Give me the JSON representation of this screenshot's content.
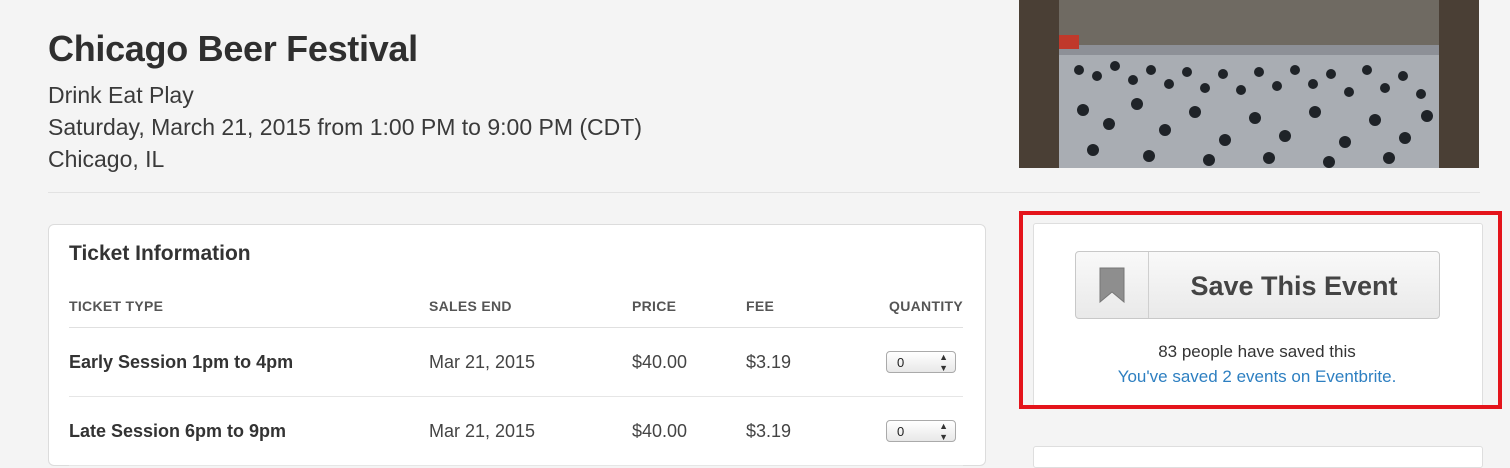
{
  "event": {
    "title": "Chicago Beer Festival",
    "subtitle": "Drink Eat Play",
    "date_time": "Saturday, March 21, 2015 from 1:00 PM to 9:00 PM (CDT)",
    "location": "Chicago, IL"
  },
  "tickets": {
    "header": "Ticket Information",
    "columns": [
      "TICKET TYPE",
      "SALES END",
      "PRICE",
      "FEE",
      "QUANTITY"
    ],
    "rows": [
      {
        "type": "Early Session 1pm to 4pm",
        "sales_end": "Mar 21, 2015",
        "price": "$40.00",
        "fee": "$3.19",
        "quantity": "0"
      },
      {
        "type": "Late Session 6pm to 9pm",
        "sales_end": "Mar 21, 2015",
        "price": "$40.00",
        "fee": "$3.19",
        "quantity": "0"
      }
    ]
  },
  "save_panel": {
    "button_label": "Save This Event",
    "icon": "bookmark-icon",
    "saved_count_text": "83 people have saved this",
    "saved_link_text": "You've saved 2 events on Eventbrite."
  },
  "colors": {
    "highlight_border": "#e4141b",
    "link": "#2d7fc1"
  }
}
